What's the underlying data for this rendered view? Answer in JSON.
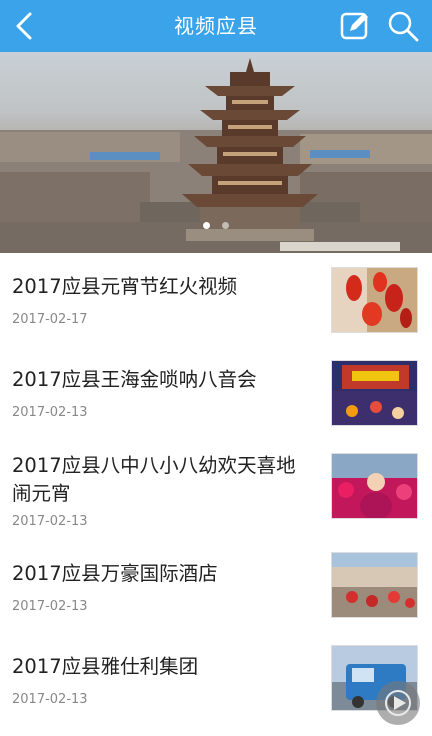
{
  "header": {
    "title": "视频应县",
    "back_icon": "chevron-left-icon",
    "edit_icon": "edit-icon",
    "search_icon": "search-icon",
    "bar_color": "#3ba3ea"
  },
  "banner": {
    "image": "wooden-pagoda-aerial-photo",
    "slide_count": 2,
    "active_slide": 1
  },
  "videos": [
    {
      "title": "2017应县元宵节红火视频",
      "date": "2017-02-17"
    },
    {
      "title": "2017应县王海金唢呐八音会",
      "date": "2017-02-13"
    },
    {
      "title": "2017应县八中八小八幼欢天喜地闹元宵",
      "date": "2017-02-13"
    },
    {
      "title": "2017应县万豪国际酒店",
      "date": "2017-02-13"
    },
    {
      "title": "2017应县雅仕利集团",
      "date": "2017-02-13"
    }
  ],
  "floating_button": {
    "icon": "play-circle-icon"
  }
}
